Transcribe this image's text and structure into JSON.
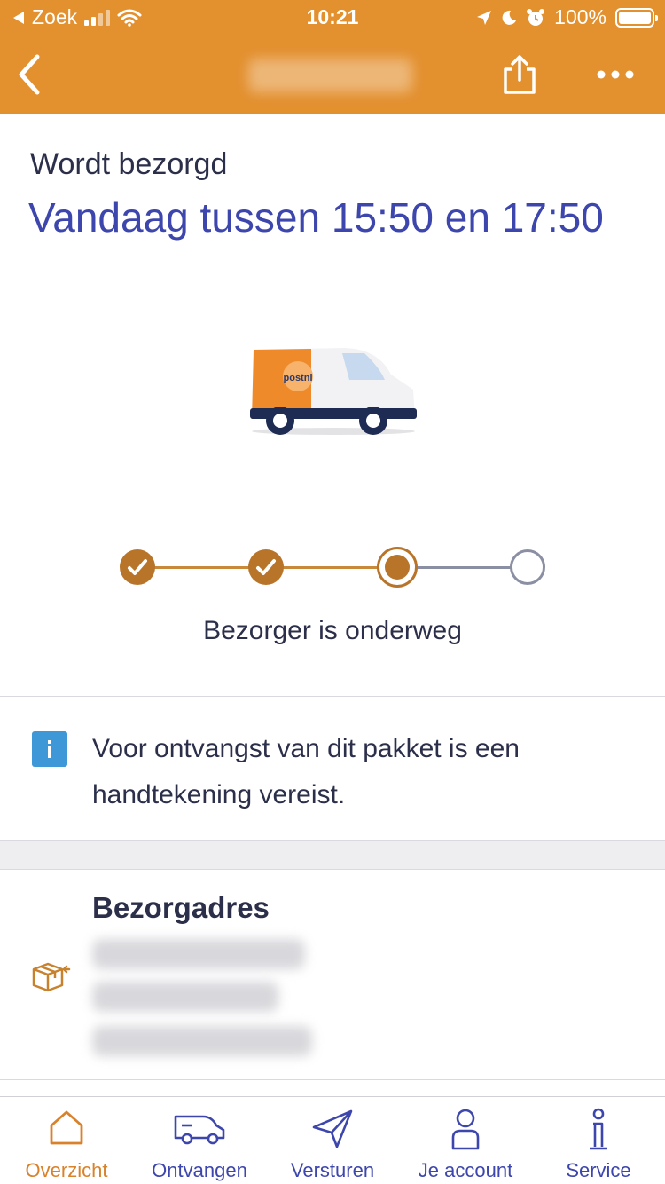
{
  "status_bar": {
    "carrier": "Zoek",
    "time": "10:21",
    "battery": "100%"
  },
  "nav": {
    "back_icon": "chevron-left-icon",
    "share_icon": "share-icon",
    "more_icon": "more-icon"
  },
  "delivery": {
    "status_label": "Wordt bezorgd",
    "eta": "Vandaag tussen 15:50 en 17:50",
    "van_brand": "postnl"
  },
  "progress": {
    "steps_total": 4,
    "current_step": 3,
    "current_label": "Bezorger is onderweg"
  },
  "notice": {
    "icon": "info-icon",
    "text_line1": "Voor ontvangst van dit pakket is een",
    "text_line2": "handtekening vereist."
  },
  "address": {
    "title": "Bezorgadres",
    "icon": "package-return-icon"
  },
  "tabs": [
    {
      "label": "Overzicht",
      "icon": "home-icon",
      "active": true
    },
    {
      "label": "Ontvangen",
      "icon": "van-icon",
      "active": false
    },
    {
      "label": "Versturen",
      "icon": "paper-plane-icon",
      "active": false
    },
    {
      "label": "Je account",
      "icon": "user-icon",
      "active": false
    },
    {
      "label": "Service",
      "icon": "info-icon",
      "active": false
    }
  ],
  "colors": {
    "brand_orange": "#e3902f",
    "accent_blue": "#3d46ac",
    "step_done": "#b8752a",
    "step_pending": "#8a8fa3",
    "info_blue": "#3e98d7"
  }
}
